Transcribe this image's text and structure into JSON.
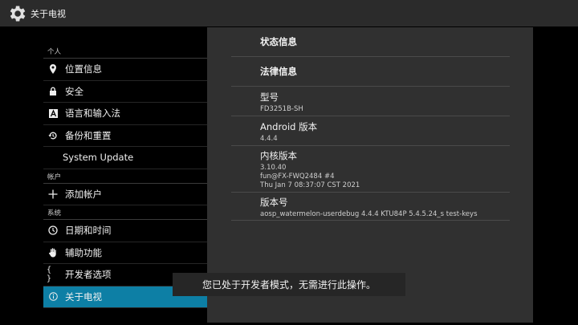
{
  "topbar": {
    "title": "关于电视",
    "icon": "gear-icon"
  },
  "sidebar": {
    "sections": [
      {
        "header": "个人"
      },
      {
        "header": "帐户"
      },
      {
        "header": "系统"
      }
    ],
    "items": [
      {
        "label": "位置信息",
        "icon": "location-pin-icon"
      },
      {
        "label": "安全",
        "icon": "lock-icon"
      },
      {
        "label": "语言和输入法",
        "icon": "keyboard-a-icon"
      },
      {
        "label": "备份和重置",
        "icon": "restore-icon"
      },
      {
        "label": "System Update",
        "icon": ""
      },
      {
        "label": "添加帐户",
        "icon": "plus-icon"
      },
      {
        "label": "日期和时间",
        "icon": "clock-icon"
      },
      {
        "label": "辅助功能",
        "icon": "hand-icon"
      },
      {
        "label": "开发者选项",
        "icon": "braces-icon"
      },
      {
        "label": "关于电视",
        "icon": "info-icon",
        "selected": true
      }
    ],
    "selected_color": "#0d7fa5"
  },
  "panel": {
    "rows": [
      {
        "title": "状态信息"
      },
      {
        "title": "法律信息"
      },
      {
        "title": "型号",
        "lines": [
          "FD3251B-SH"
        ]
      },
      {
        "title": "Android 版本",
        "lines": [
          "4.4.4"
        ]
      },
      {
        "title": "内核版本",
        "lines": [
          "3.10.40",
          "fun@FX-FWQ2484 #4",
          "Thu Jan 7 08:37:07 CST 2021"
        ]
      },
      {
        "title": "版本号",
        "lines": [
          "aosp_watermelon-userdebug 4.4.4 KTU84P 5.4.5.24_s test-keys"
        ]
      }
    ]
  },
  "toast": {
    "text": "您已处于开发者模式，无需进行此操作。"
  }
}
